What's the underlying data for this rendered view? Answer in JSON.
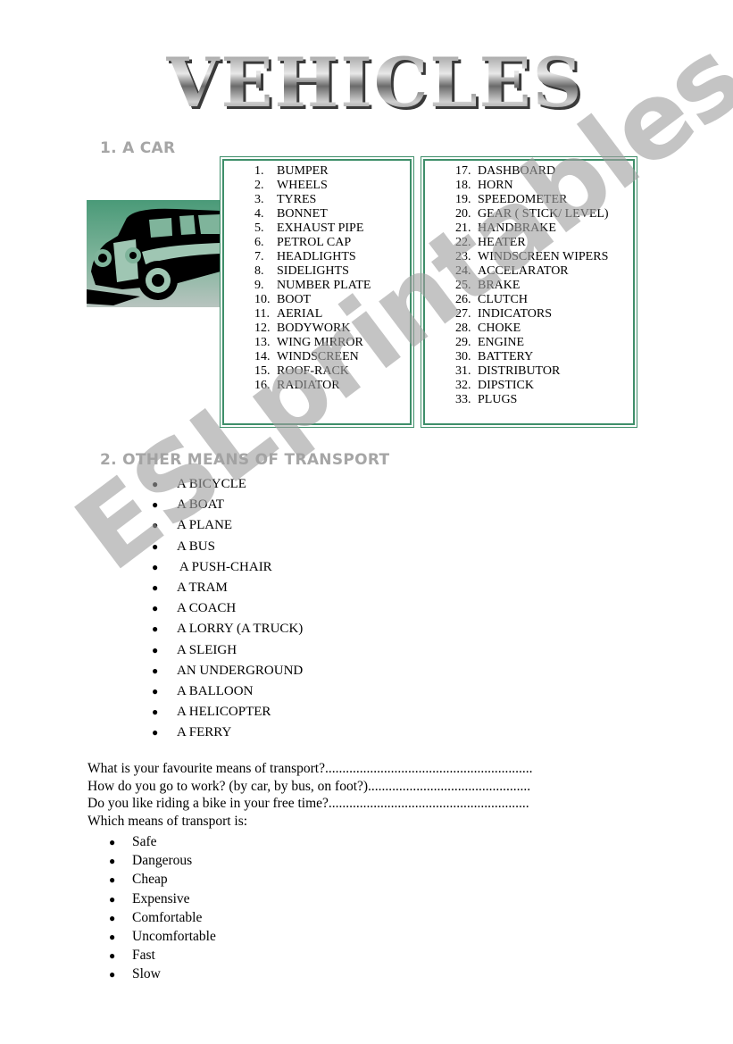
{
  "title": "VEHICLES",
  "sections": {
    "car": {
      "heading": "1. A CAR",
      "image_icon": "vintage-car-icon",
      "parts_column_1": [
        {
          "num": "1.",
          "label": "BUMPER"
        },
        {
          "num": "2.",
          "label": "WHEELS"
        },
        {
          "num": "3.",
          "label": "TYRES"
        },
        {
          "num": "4.",
          "label": "BONNET"
        },
        {
          "num": "5.",
          "label": "EXHAUST PIPE"
        },
        {
          "num": "6.",
          "label": "PETROL CAP"
        },
        {
          "num": "7.",
          "label": "HEADLIGHTS"
        },
        {
          "num": "8.",
          "label": "SIDELIGHTS"
        },
        {
          "num": "9.",
          "label": "NUMBER PLATE"
        },
        {
          "num": "10.",
          "label": "BOOT"
        },
        {
          "num": "11.",
          "label": "AERIAL"
        },
        {
          "num": "12.",
          "label": "BODYWORK"
        },
        {
          "num": "13.",
          "label": "WING MIRROR"
        },
        {
          "num": "14.",
          "label": "WINDSCREEN"
        },
        {
          "num": "15.",
          "label": "ROOF-RACK"
        },
        {
          "num": "16.",
          "label": "RADIATOR"
        }
      ],
      "parts_column_2": [
        {
          "num": "17.",
          "label": "DASHBOARD"
        },
        {
          "num": "18.",
          "label": "HORN"
        },
        {
          "num": "19.",
          "label": "SPEEDOMETER"
        },
        {
          "num": "20.",
          "label": "GEAR ( STICK/ LEVEL)"
        },
        {
          "num": "21.",
          "label": "HANDBRAKE"
        },
        {
          "num": "22.",
          "label": "HEATER"
        },
        {
          "num": "23.",
          "label": "WINDSCREEN WIPERS"
        },
        {
          "num": "24.",
          "label": "ACCELARATOR"
        },
        {
          "num": "25.",
          "label": "BRAKE"
        },
        {
          "num": "26.",
          "label": "CLUTCH"
        },
        {
          "num": "27.",
          "label": "INDICATORS"
        },
        {
          "num": "28.",
          "label": "CHOKE"
        },
        {
          "num": "29.",
          "label": "ENGINE"
        },
        {
          "num": "30.",
          "label": "BATTERY"
        },
        {
          "num": "31.",
          "label": "DISTRIBUTOR"
        },
        {
          "num": "32.",
          "label": "DIPSTICK"
        },
        {
          "num": "33.",
          "label": "PLUGS"
        }
      ]
    },
    "transport": {
      "heading": "2. OTHER MEANS OF TRANSPORT",
      "items": [
        "A BICYCLE",
        "A BOAT",
        "A PLANE",
        "A BUS",
        " A PUSH-CHAIR",
        "A TRAM",
        "A COACH",
        "A LORRY (A TRUCK)",
        "A SLEIGH",
        "AN UNDERGROUND",
        "A BALLOON",
        "A HELICOPTER",
        "A FERRY"
      ]
    },
    "questions": {
      "lines": [
        "What is your favourite means of transport?............................................................",
        "How do  you go to work? (by car, by bus, on foot?)...............................................",
        "Do you like riding a bike in your free time?..........................................................",
        "Which means of transport is:"
      ],
      "adjectives": [
        "Safe",
        "Dangerous",
        "Cheap",
        "Expensive",
        "Comfortable",
        "Uncomfortable",
        "Fast",
        "Slow"
      ]
    }
  },
  "bullet_glyph": "●",
  "watermark": "ESLprintables.com",
  "colors": {
    "box_border": "#3f8f6a",
    "heading_gray": "#a6a6a6",
    "car_bg": "#4a9a78"
  }
}
